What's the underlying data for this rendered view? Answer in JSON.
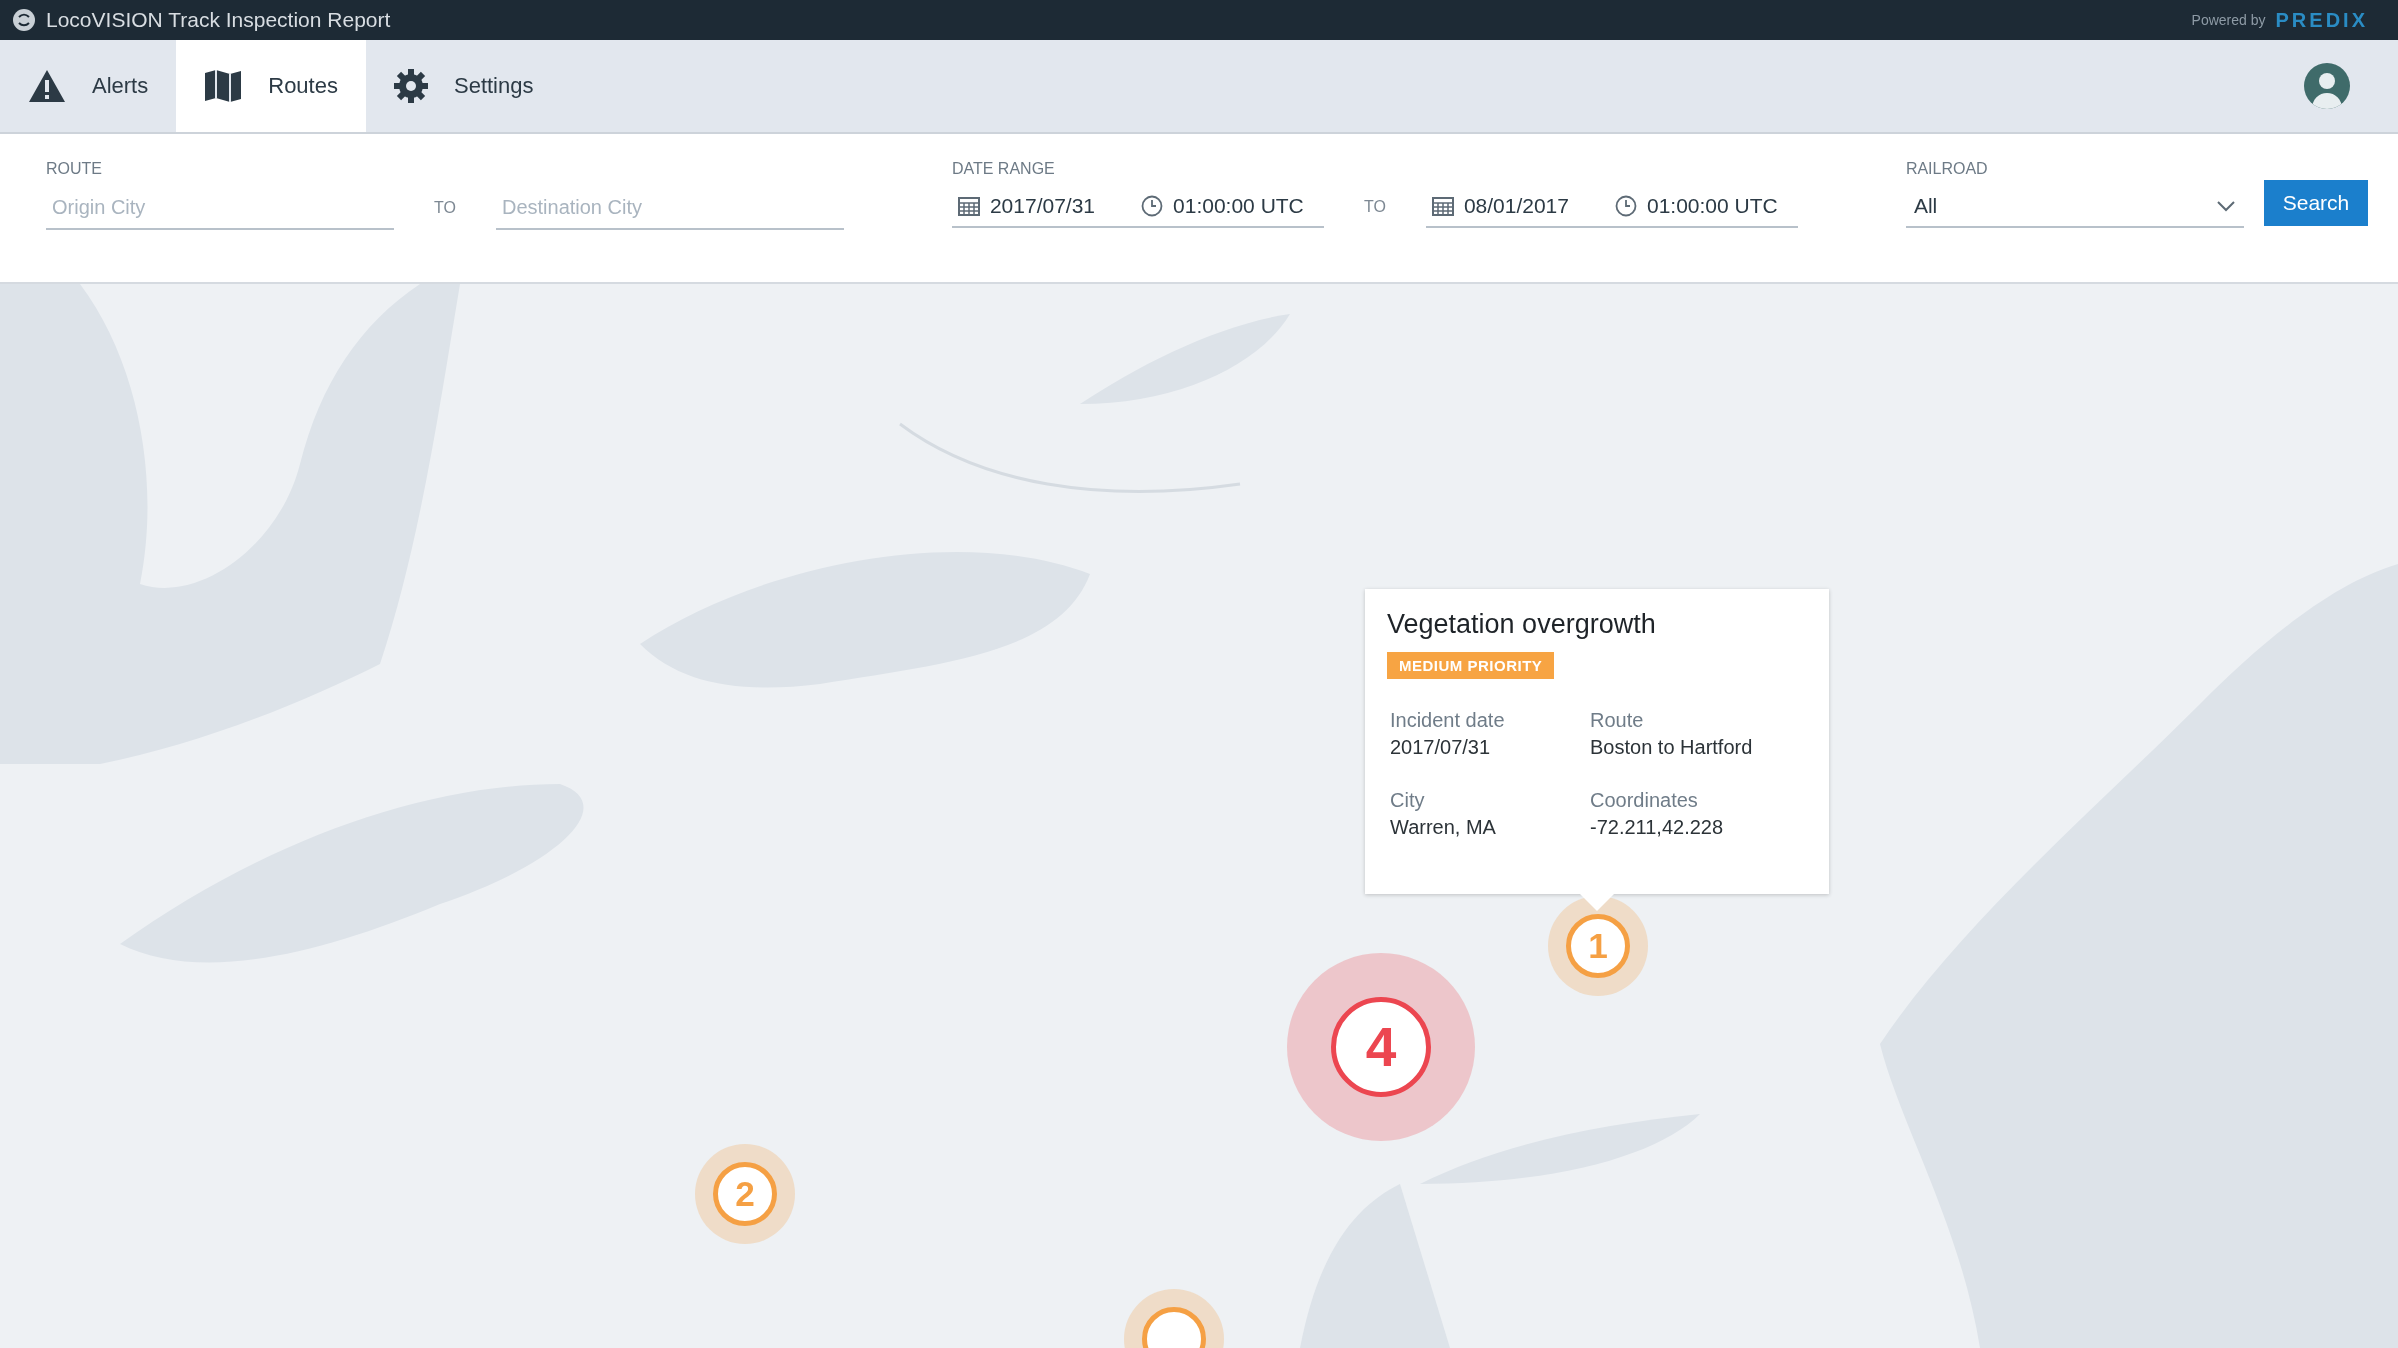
{
  "app_bar": {
    "title": "LocoVISION Track Inspection Report",
    "powered_by": "Powered by",
    "brand": "PREDIX"
  },
  "nav": {
    "tabs": [
      {
        "label": "Alerts",
        "selected": false
      },
      {
        "label": "Routes",
        "selected": true
      },
      {
        "label": "Settings",
        "selected": false
      }
    ]
  },
  "filters": {
    "route": {
      "label": "ROUTE",
      "origin_placeholder": "Origin City",
      "to": "TO",
      "destination_placeholder": "Destination City"
    },
    "date_range": {
      "label": "DATE RANGE",
      "from_date": "2017/07/31",
      "from_time": "01:00:00 UTC",
      "to": "TO",
      "to_date": "08/01/2017",
      "to_time": "01:00:00 UTC"
    },
    "railroad": {
      "label": "RAILROAD",
      "value": "All"
    },
    "search_button": "Search"
  },
  "map": {
    "markers": [
      {
        "count": "1",
        "color": "#f5a044"
      },
      {
        "count": "4",
        "color": "#ec4650"
      },
      {
        "count": "2",
        "color": "#f5a044"
      },
      {
        "color": "#f5a044"
      }
    ],
    "popup": {
      "title": "Vegetation overgrowth",
      "priority": "MEDIUM PRIORITY",
      "fields": [
        {
          "label": "Incident date",
          "value": "2017/07/31"
        },
        {
          "label": "Route",
          "value": "Boston to Hartford"
        },
        {
          "label": "City",
          "value": "Warren, MA"
        },
        {
          "label": "Coordinates",
          "value": "-72.211,42.228"
        }
      ]
    }
  }
}
